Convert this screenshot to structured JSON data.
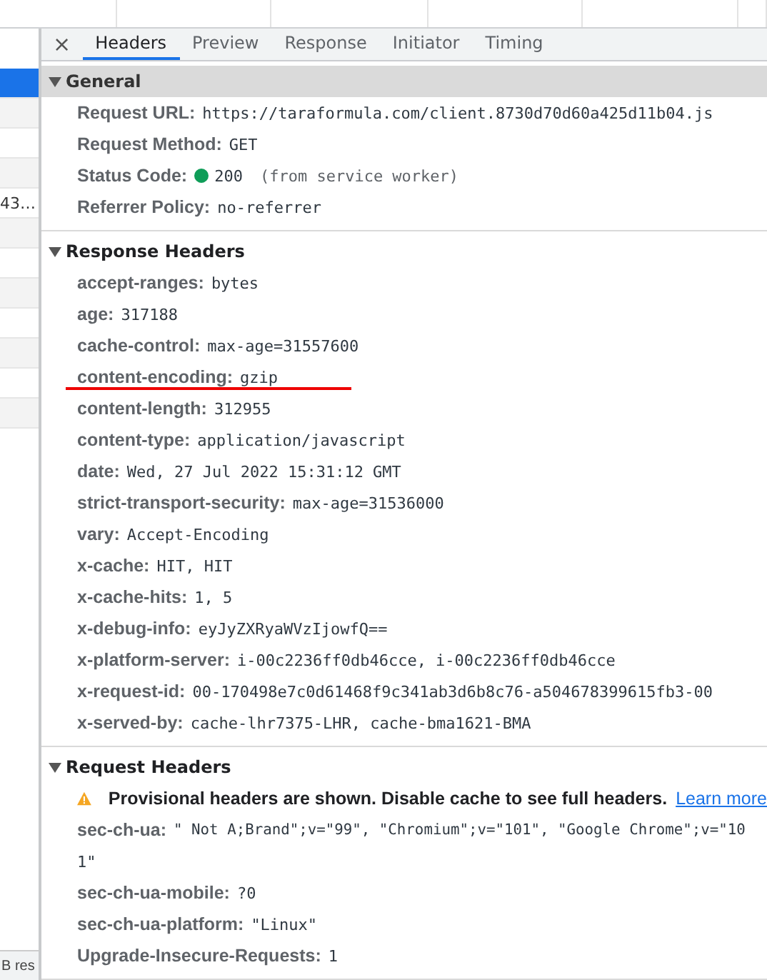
{
  "request_list": {
    "rows": [
      {
        "selected": true
      },
      {
        "selected": false
      },
      {
        "selected": false
      },
      {
        "selected": false
      },
      {
        "selected": false,
        "text": "43…"
      },
      {
        "selected": false
      },
      {
        "selected": false
      },
      {
        "selected": false
      },
      {
        "selected": false
      },
      {
        "selected": false
      },
      {
        "selected": false
      },
      {
        "selected": false
      }
    ],
    "status_text": "B res"
  },
  "tabs": [
    {
      "label": "Headers",
      "selected": true
    },
    {
      "label": "Preview",
      "selected": false
    },
    {
      "label": "Response",
      "selected": false
    },
    {
      "label": "Initiator",
      "selected": false
    },
    {
      "label": "Timing",
      "selected": false
    }
  ],
  "close_label": "×",
  "sections": [
    {
      "title": "General",
      "expanded": true,
      "focused": true,
      "rows": [
        {
          "name": "Request URL:",
          "value": "https://taraformula.com/client.8730d70d60a425d11b04.js"
        },
        {
          "name": "Request Method:",
          "value": "GET"
        },
        {
          "name": "Status Code:",
          "color": "#0f9d58",
          "value": "200",
          "note": "(from service worker)"
        },
        {
          "name": "Referrer Policy:",
          "value": "no-referrer"
        }
      ]
    },
    {
      "title": "Response Headers",
      "expanded": true,
      "focused": false,
      "rows": [
        {
          "name": "accept-ranges:",
          "value": "bytes"
        },
        {
          "name": "age:",
          "value": "317188"
        },
        {
          "name": "cache-control:",
          "value": "max-age=31557600"
        },
        {
          "name": "content-encoding:",
          "value": "gzip",
          "underlined": true
        },
        {
          "name": "content-length:",
          "value": "312955"
        },
        {
          "name": "content-type:",
          "value": "application/javascript"
        },
        {
          "name": "date:",
          "value": "Wed, 27 Jul 2022 15:31:12 GMT"
        },
        {
          "name": "strict-transport-security:",
          "value": "max-age=31536000"
        },
        {
          "name": "vary:",
          "value": "Accept-Encoding"
        },
        {
          "name": "x-cache:",
          "value": "HIT, HIT"
        },
        {
          "name": "x-cache-hits:",
          "value": "1, 5"
        },
        {
          "name": "x-debug-info:",
          "value": "eyJyZXRyaWVzIjowfQ=="
        },
        {
          "name": "x-platform-server:",
          "value": "i-00c2236ff0db46cce, i-00c2236ff0db46cce"
        },
        {
          "name": "x-request-id:",
          "value": "00-170498e7c0d61468f9c341ab3d6b8c76-a504678399615fb3-00"
        },
        {
          "name": "x-served-by:",
          "value": "cache-lhr7375-LHR, cache-bma1621-BMA"
        }
      ]
    },
    {
      "title": "Request Headers",
      "expanded": true,
      "focused": false,
      "warning": {
        "text": "Provisional headers are shown. Disable cache to see full headers.",
        "link": "Learn more"
      },
      "rows": [
        {
          "name": "sec-ch-ua:",
          "value": "\" Not A;Brand\";v=\"99\", \"Chromium\";v=\"101\", \"Google Chrome\";v=\"10",
          "continuation": "1\""
        },
        {
          "name": "sec-ch-ua-mobile:",
          "value": "?0"
        },
        {
          "name": "sec-ch-ua-platform:",
          "value": "\"Linux\""
        },
        {
          "name": "Upgrade-Insecure-Requests:",
          "value": "1"
        }
      ]
    }
  ]
}
